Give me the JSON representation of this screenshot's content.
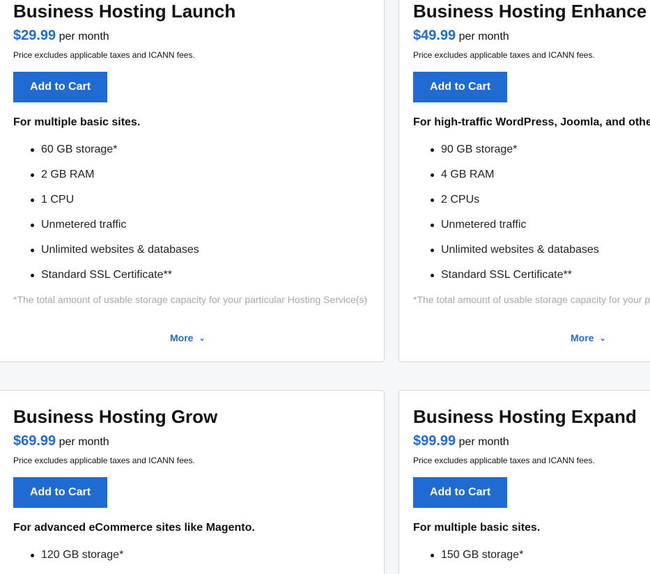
{
  "colors": {
    "accent": "#1f6bd1",
    "background": "#f5f7f8",
    "card": "#ffffff",
    "footnote": "#a8a8a8"
  },
  "icons": {
    "more": "chevron-down-icon"
  },
  "plans": [
    {
      "title": "Business Hosting Launch",
      "price": "$29.99",
      "per": "per month",
      "disclaimer": "Price excludes applicable taxes and ICANN fees.",
      "cta": "Add to Cart",
      "tagline": "For multiple basic sites.",
      "features": [
        "60 GB storage*",
        "2 GB RAM",
        "1 CPU",
        "Unmetered traffic",
        "Unlimited websites & databases",
        "Standard SSL Certificate**"
      ],
      "footnote": "*The total amount of usable storage capacity for your particular Hosting Service(s)",
      "more": "More"
    },
    {
      "title": "Business Hosting Enhance",
      "price": "$49.99",
      "per": "per month",
      "disclaimer": "Price excludes applicable taxes and ICANN fees.",
      "cta": "Add to Cart",
      "tagline": "For high-traffic WordPress, Joomla, and other",
      "features": [
        "90 GB storage*",
        "4 GB RAM",
        "2 CPUs",
        "Unmetered traffic",
        "Unlimited websites & databases",
        "Standard SSL Certificate**"
      ],
      "footnote": "*The total amount of usable storage capacity for your particular Hosting Service(s)",
      "more": "More"
    },
    {
      "title": "Business Hosting Grow",
      "price": "$69.99",
      "per": "per month",
      "disclaimer": "Price excludes applicable taxes and ICANN fees.",
      "cta": "Add to Cart",
      "tagline": "For advanced eCommerce sites like Magento.",
      "features": [
        "120 GB storage*"
      ]
    },
    {
      "title": "Business Hosting Expand",
      "price": "$99.99",
      "per": "per month",
      "disclaimer": "Price excludes applicable taxes and ICANN fees.",
      "cta": "Add to Cart",
      "tagline": "For multiple basic sites.",
      "features": [
        "150 GB storage*"
      ]
    }
  ]
}
